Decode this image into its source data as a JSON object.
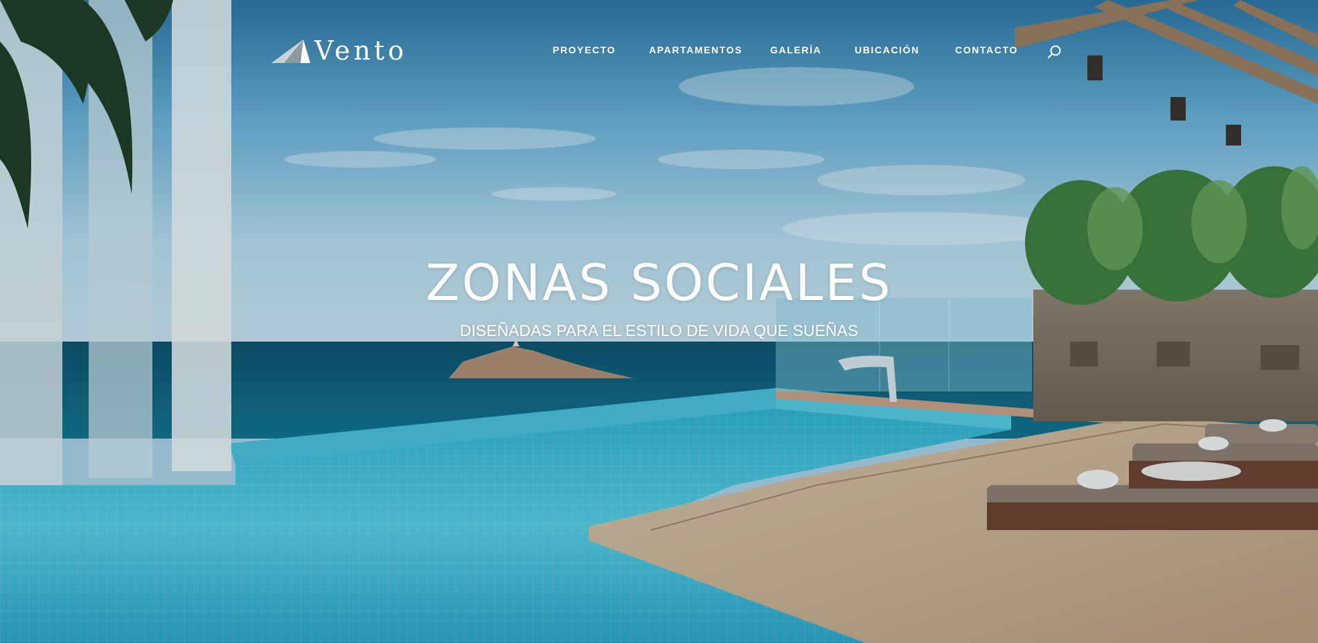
{
  "brand": {
    "logo_text": "Vento",
    "logo_icon": "triangle-mark-icon"
  },
  "nav": {
    "items": [
      {
        "label": "PROYECTO"
      },
      {
        "label": "APARTAMENTOS"
      },
      {
        "label": "GALERÍA"
      },
      {
        "label": "UBICACIÓN"
      },
      {
        "label": "CONTACTO"
      }
    ],
    "search_icon": "search-icon"
  },
  "hero": {
    "title": "ZONAS SOCIALES",
    "subtitle": "DISEÑADAS PARA EL ESTILO DE VIDA QUE SUEÑAS"
  },
  "colors": {
    "text": "#ffffff",
    "pool": "#3fbfd6",
    "sea": "#0f5f78",
    "sky": "#5aa4cc"
  }
}
